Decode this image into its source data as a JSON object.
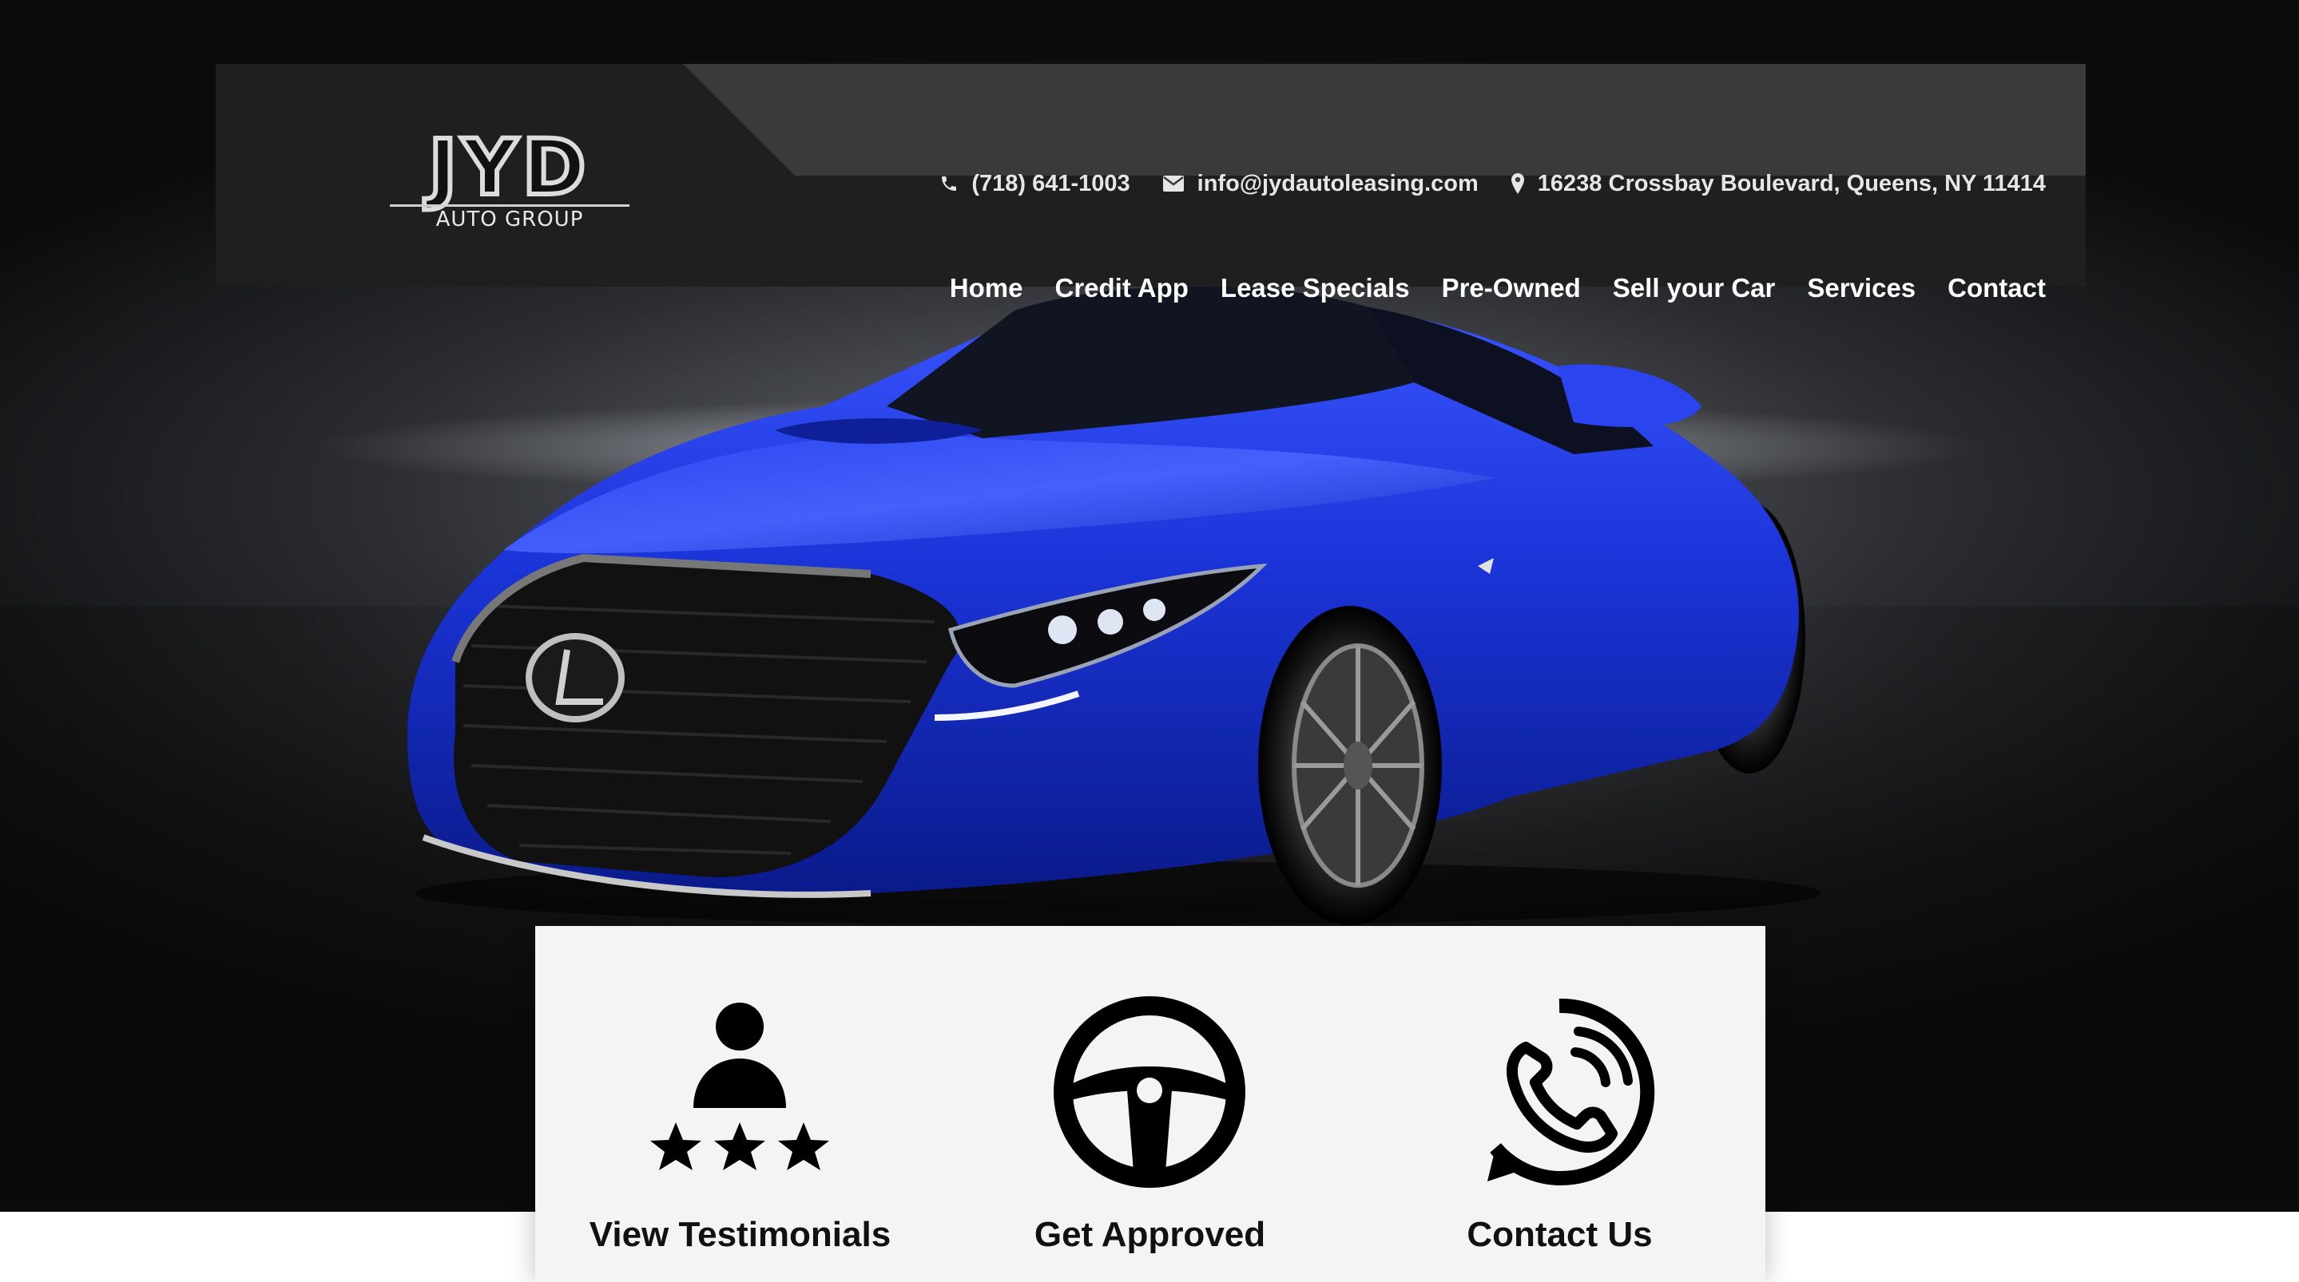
{
  "brand": {
    "logo_main": "JYD",
    "logo_sub": "AUTO GROUP"
  },
  "contact": {
    "phone": "(718) 641-1003",
    "email": "info@jydautoleasing.com",
    "address": "16238 Crossbay Boulevard, Queens, NY 11414",
    "icons": [
      "phone-icon",
      "envelope-icon",
      "map-pin-icon"
    ]
  },
  "nav": {
    "items": [
      {
        "label": "Home"
      },
      {
        "label": "Credit App"
      },
      {
        "label": "Lease Specials"
      },
      {
        "label": "Pre-Owned"
      },
      {
        "label": "Sell your Car"
      },
      {
        "label": "Services"
      },
      {
        "label": "Contact"
      }
    ]
  },
  "cards": [
    {
      "label": "View Testimonials",
      "icon": "person-stars-icon"
    },
    {
      "label": "Get Approved",
      "icon": "steering-wheel-icon"
    },
    {
      "label": "Contact Us",
      "icon": "phone-call-icon"
    }
  ],
  "colors": {
    "header_bg": "#1f1f1f",
    "topbar_bg": "#3a3a3a",
    "card_bg": "#f4f4f4",
    "car_blue": "#1a33d6"
  }
}
